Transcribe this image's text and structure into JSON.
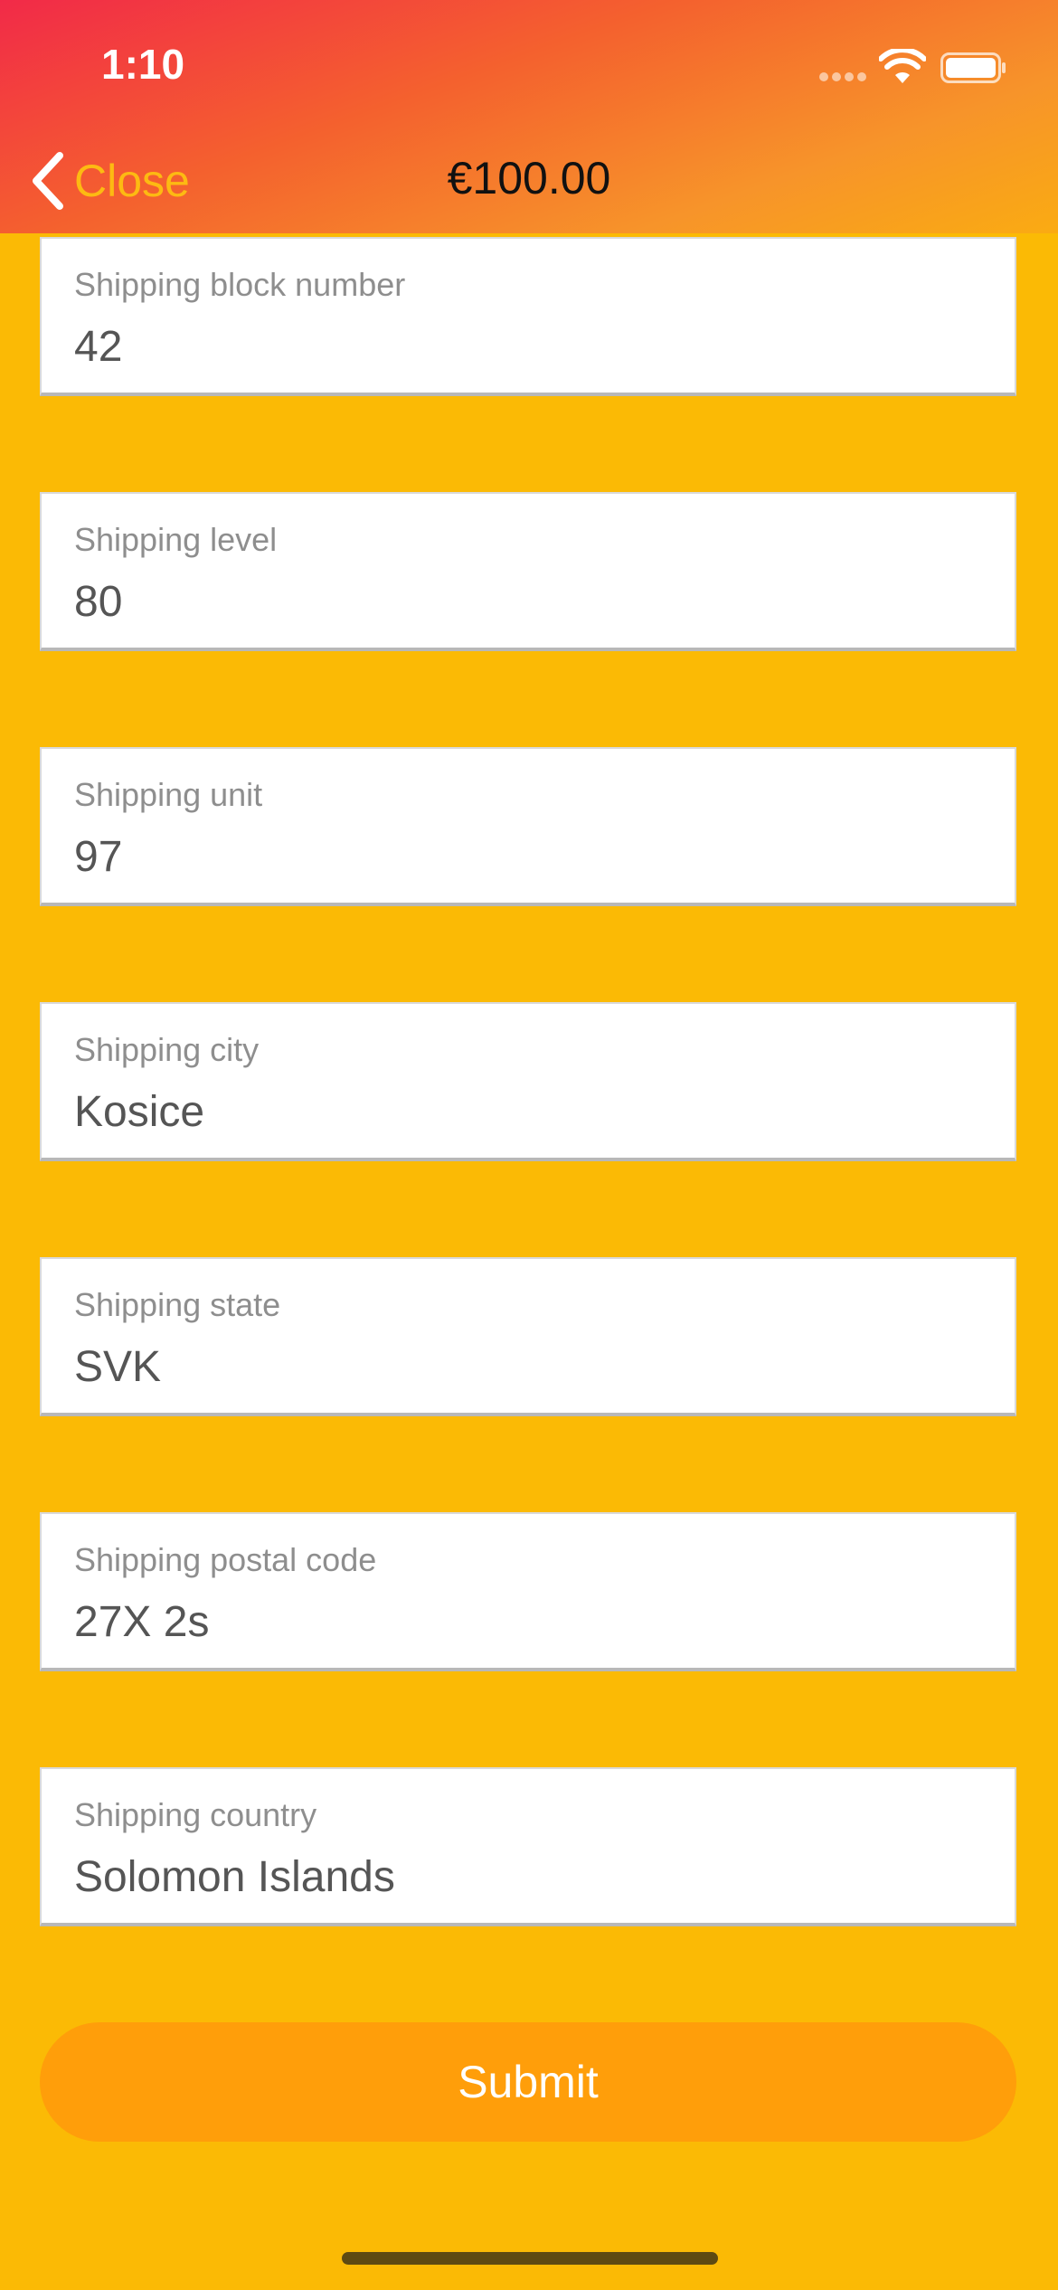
{
  "status_bar": {
    "time": "1:10",
    "icons": [
      "signal-icon",
      "wifi-icon",
      "battery-icon"
    ]
  },
  "nav": {
    "close_label": "Close",
    "back_icon": "chevron-left-icon",
    "title": "€100.00"
  },
  "form": {
    "fields": [
      {
        "label": "Shipping block number",
        "value": "42"
      },
      {
        "label": "Shipping level",
        "value": "80"
      },
      {
        "label": "Shipping unit",
        "value": "97"
      },
      {
        "label": "Shipping city",
        "value": "Kosice"
      },
      {
        "label": "Shipping state",
        "value": "SVK"
      },
      {
        "label": "Shipping postal code",
        "value": "27X 2s"
      },
      {
        "label": "Shipping country",
        "value": "Solomon Islands"
      }
    ],
    "submit_label": "Submit"
  },
  "colors": {
    "background": "#FBBA05",
    "header_gradient_start": "#F22A48",
    "header_gradient_end": "#FAAB12",
    "accent": "#FDBA12",
    "submit_button": "#FF9E0A"
  }
}
